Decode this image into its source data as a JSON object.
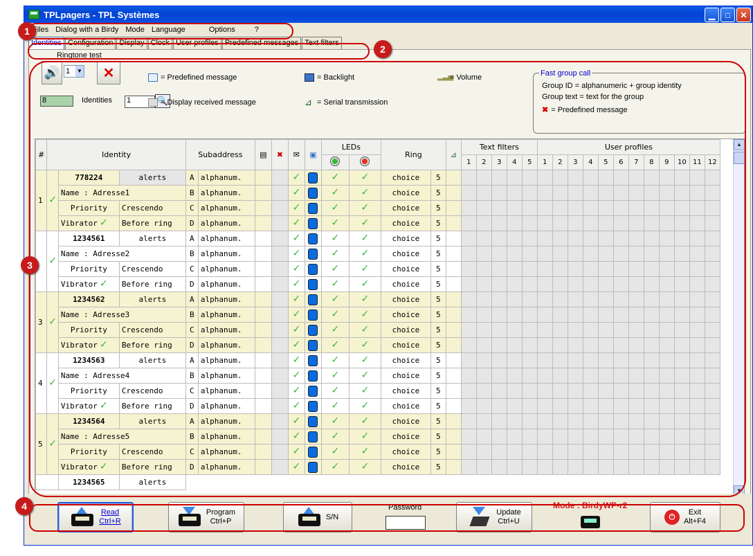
{
  "window": {
    "title": "TPLpagers - TPL Systèmes"
  },
  "menu": [
    "Files",
    "Dialog with a Birdy",
    "Mode",
    "Language",
    "Options",
    "?"
  ],
  "tabs": [
    "Identities",
    "Configuration",
    "Display",
    "Clock",
    "User profiles",
    "Predefined messages",
    "Text filters"
  ],
  "ringtone": {
    "label": "Ringtone test",
    "value": "1"
  },
  "identities_count": {
    "value": "8",
    "label": "Identities"
  },
  "search": {
    "value": "1"
  },
  "legend": {
    "predefined": "= Predefined message",
    "display_received": "= Display received message",
    "backlight": "= Backlight",
    "serial": "= Serial transmission",
    "volume": "= Volume"
  },
  "fast_group": {
    "title": "Fast group call",
    "line1": "Group ID = alphanumeric + group identity",
    "line2": "Group text = text for the group",
    "line3": "= Predefined message"
  },
  "table": {
    "headers": {
      "num": "#",
      "identity": "Identity",
      "subaddress": "Subaddress",
      "leds": "LEDs",
      "ring": "Ring",
      "text_filters": "Text filters",
      "user_profiles": "User profiles"
    },
    "tf_cols": [
      "1",
      "2",
      "3",
      "4",
      "5"
    ],
    "up_cols": [
      "1",
      "2",
      "3",
      "4",
      "5",
      "6",
      "7",
      "8",
      "9",
      "10",
      "11",
      "12"
    ],
    "sub_letters": [
      "A",
      "B",
      "C",
      "D"
    ],
    "sub_value": "alphanum.",
    "ring_value": "choice",
    "ring_vol": "5",
    "priority_label": "Priority",
    "priority_value": "Crescendo",
    "vibrator_label": "Vibrator",
    "vibrator_value": "Before ring",
    "alerts": "alerts",
    "entries": [
      {
        "num": "1",
        "id": "778224",
        "name": "Name : Adresse1",
        "style": "y"
      },
      {
        "num": "",
        "id": "1234561",
        "name": "Name : Adresse2",
        "style": "w"
      },
      {
        "num": "3",
        "id": "1234562",
        "name": "Name : Adresse3",
        "style": "y"
      },
      {
        "num": "4",
        "id": "1234563",
        "name": "Name : Adresse4",
        "style": "w"
      },
      {
        "num": "5",
        "id": "1234564",
        "name": "Name : Adresse5",
        "style": "y"
      }
    ],
    "partial_id": "1234565"
  },
  "bottom": {
    "read": {
      "l1": "Read",
      "l2": "Ctrl+R"
    },
    "program": {
      "l1": "Program",
      "l2": "Ctrl+P"
    },
    "sn": "S/N",
    "password": "Password",
    "update": {
      "l1": "Update",
      "l2": "Ctrl+U"
    },
    "mode": "Mode : BirdyWP-r2",
    "exit": {
      "l1": "Exit",
      "l2": "Alt+F4"
    }
  },
  "badges": [
    "1",
    "2",
    "3",
    "4"
  ]
}
